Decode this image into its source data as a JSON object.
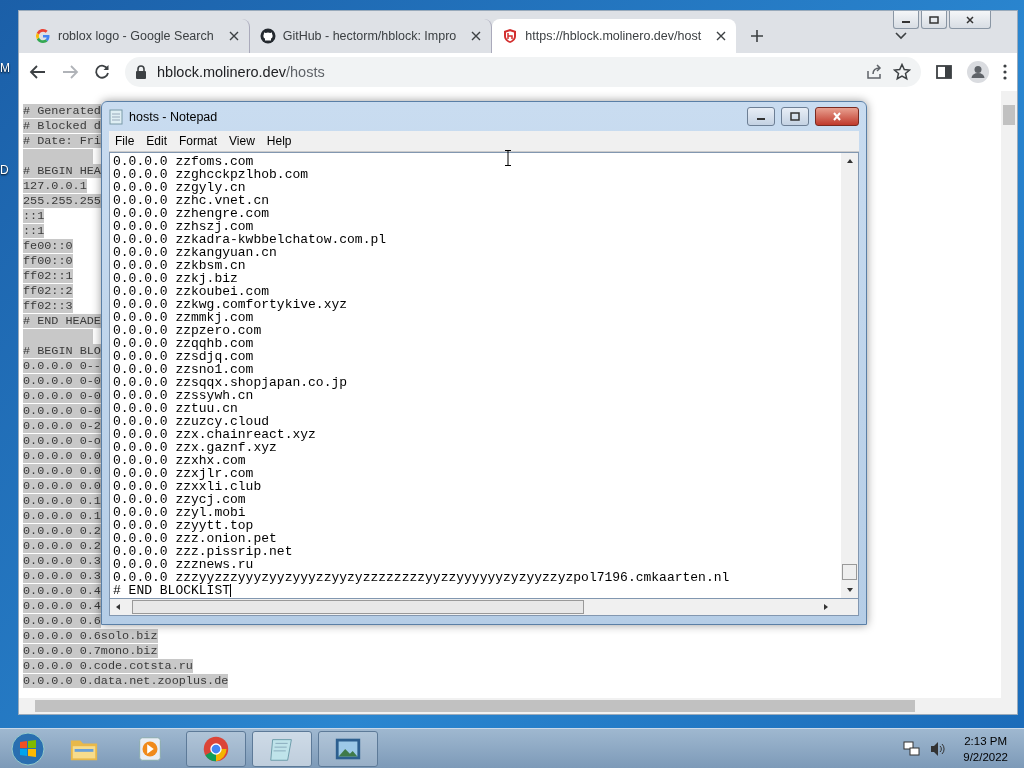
{
  "desktop": {
    "icon_labels": [
      "M",
      "D"
    ]
  },
  "browser": {
    "tabs": [
      {
        "title": "roblox logo - Google Search",
        "selected": false
      },
      {
        "title": "GitHub - hectorm/hblock: Impro",
        "selected": false
      },
      {
        "title": "https://hblock.molinero.dev/host",
        "selected": true
      }
    ],
    "address": {
      "host": "hblock.molinero.dev",
      "path": "/hosts"
    },
    "forward_disabled": true,
    "page_lines": [
      {
        "kind": "text",
        "text": "# Generated"
      },
      {
        "kind": "text",
        "text": "# Blocked d"
      },
      {
        "kind": "text",
        "text": "# Date: Fri"
      },
      {
        "kind": "blank"
      },
      {
        "kind": "text",
        "text": "# BEGIN HEA"
      },
      {
        "kind": "text",
        "text": "127.0.0.1"
      },
      {
        "kind": "text",
        "text": "255.255.255"
      },
      {
        "kind": "text",
        "text": "::1"
      },
      {
        "kind": "text",
        "text": "::1"
      },
      {
        "kind": "text",
        "text": "fe00::0"
      },
      {
        "kind": "text",
        "text": "ff00::0"
      },
      {
        "kind": "text",
        "text": "ff02::1"
      },
      {
        "kind": "text",
        "text": "ff02::2"
      },
      {
        "kind": "text",
        "text": "ff02::3"
      },
      {
        "kind": "text",
        "text": "# END HEADE"
      },
      {
        "kind": "blank"
      },
      {
        "kind": "text",
        "text": "# BEGIN BLO"
      },
      {
        "kind": "text",
        "text": "0.0.0.0 0--"
      },
      {
        "kind": "text",
        "text": "0.0.0.0 0-0"
      },
      {
        "kind": "text",
        "text": "0.0.0.0 0-0"
      },
      {
        "kind": "text",
        "text": "0.0.0.0 0-0"
      },
      {
        "kind": "text",
        "text": "0.0.0.0 0-2"
      },
      {
        "kind": "text",
        "text": "0.0.0.0 0-o"
      },
      {
        "kind": "text",
        "text": "0.0.0.0 0.0"
      },
      {
        "kind": "text",
        "text": "0.0.0.0 0.0"
      },
      {
        "kind": "text",
        "text": "0.0.0.0 0.0"
      },
      {
        "kind": "text",
        "text": "0.0.0.0 0.1"
      },
      {
        "kind": "text",
        "text": "0.0.0.0 0.1"
      },
      {
        "kind": "text",
        "text": "0.0.0.0 0.2"
      },
      {
        "kind": "text",
        "text": "0.0.0.0 0.2"
      },
      {
        "kind": "text",
        "text": "0.0.0.0 0.3"
      },
      {
        "kind": "text",
        "text": "0.0.0.0 0.3"
      },
      {
        "kind": "text",
        "text": "0.0.0.0 0.4"
      },
      {
        "kind": "text",
        "text": "0.0.0.0 0.4"
      },
      {
        "kind": "text",
        "text": "0.0.0.0 0.6"
      },
      {
        "kind": "text",
        "text": "0.0.0.0 0.6solo.biz"
      },
      {
        "kind": "text",
        "text": "0.0.0.0 0.7mono.biz"
      },
      {
        "kind": "text",
        "text": "0.0.0.0 0.code.cotsta.ru"
      },
      {
        "kind": "text",
        "text": "0.0.0.0 0.data.net.zooplus.de"
      }
    ]
  },
  "notepad": {
    "title": "hosts - Notepad",
    "menu": [
      "File",
      "Edit",
      "Format",
      "View",
      "Help"
    ],
    "lines": [
      "0.0.0.0 zzfoms.com",
      "0.0.0.0 zzghcckpzlhob.com",
      "0.0.0.0 zzgyly.cn",
      "0.0.0.0 zzhc.vnet.cn",
      "0.0.0.0 zzhengre.com",
      "0.0.0.0 zzhszj.com",
      "0.0.0.0 zzkadra-kwbbelchatow.com.pl",
      "0.0.0.0 zzkangyuan.cn",
      "0.0.0.0 zzkbsm.cn",
      "0.0.0.0 zzkj.biz",
      "0.0.0.0 zzkoubei.com",
      "0.0.0.0 zzkwg.comfortykive.xyz",
      "0.0.0.0 zzmmkj.com",
      "0.0.0.0 zzpzero.com",
      "0.0.0.0 zzqqhb.com",
      "0.0.0.0 zzsdjq.com",
      "0.0.0.0 zzsno1.com",
      "0.0.0.0 zzsqqx.shopjapan.co.jp",
      "0.0.0.0 zzssywh.cn",
      "0.0.0.0 zztuu.cn",
      "0.0.0.0 zzuzcy.cloud",
      "0.0.0.0 zzx.chainreact.xyz",
      "0.0.0.0 zzx.gaznf.xyz",
      "0.0.0.0 zzxhx.com",
      "0.0.0.0 zzxjlr.com",
      "0.0.0.0 zzxxli.club",
      "0.0.0.0 zzycj.com",
      "0.0.0.0 zzyl.mobi",
      "0.0.0.0 zzyytt.top",
      "0.0.0.0 zzz.onion.pet",
      "0.0.0.0 zzz.pissrip.net",
      "0.0.0.0 zzznews.ru",
      "0.0.0.0 zzzyyzzzyyyzyyzyyyzzyyzyzzzzzzzzyyzzyyyyyyzyzyyzzyzpol7196.cmkaarten.nl",
      "# END BLOCKLIST"
    ]
  },
  "taskbar": {
    "items": [
      {
        "kind": "pinned",
        "selected": false
      },
      {
        "kind": "pinned",
        "selected": false
      },
      {
        "kind": "running",
        "selected": false
      },
      {
        "kind": "running",
        "selected": true
      },
      {
        "kind": "running",
        "selected": false
      }
    ],
    "clock": {
      "time": "2:13 PM",
      "date": "9/2/2022"
    }
  }
}
